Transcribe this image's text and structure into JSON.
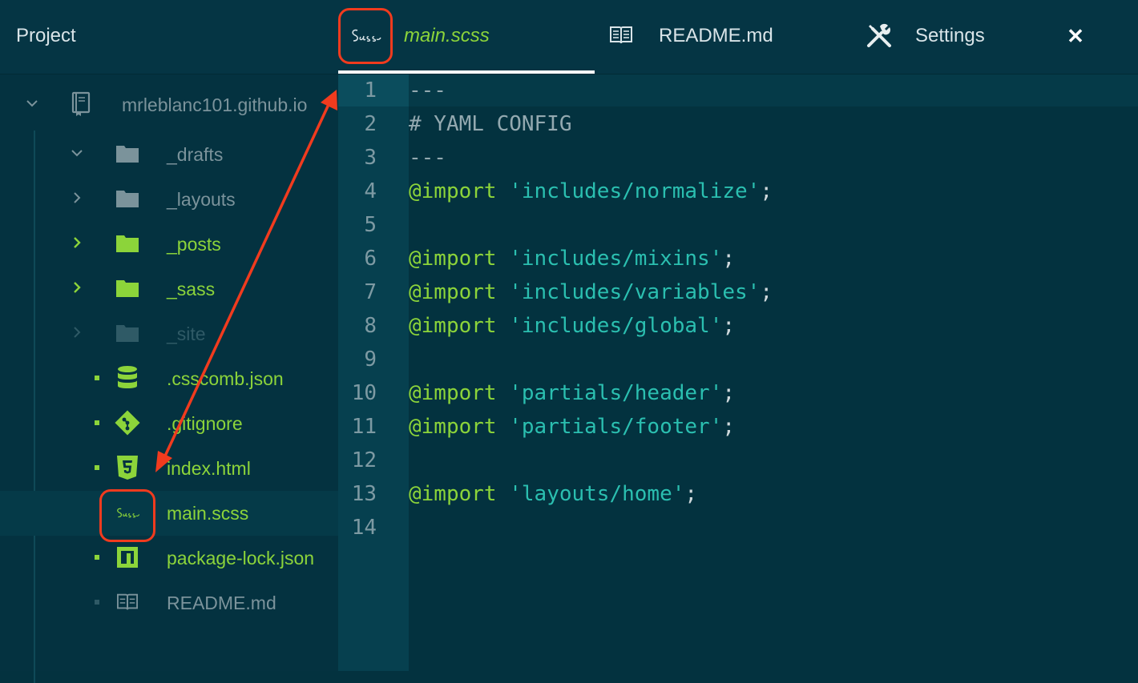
{
  "topbar": {
    "project_label": "Project",
    "tabs": [
      {
        "label": "main.scss",
        "icon": "sass-icon",
        "active": true
      },
      {
        "label": "README.md",
        "icon": "book-icon",
        "active": false
      },
      {
        "label": "Settings",
        "icon": "tools-icon",
        "active": false
      }
    ],
    "close_glyph": "✕"
  },
  "sidebar": {
    "root": {
      "label": "mrleblanc101.github.io",
      "icon": "repo-icon",
      "expanded": true
    },
    "items": [
      {
        "label": "_drafts",
        "type": "folder",
        "expanded": true,
        "color": "#7b939b"
      },
      {
        "label": "_layouts",
        "type": "folder",
        "expanded": false,
        "color": "#7b939b"
      },
      {
        "label": "_posts",
        "type": "folder",
        "expanded": false,
        "color": "#8cd43a"
      },
      {
        "label": "_sass",
        "type": "folder",
        "expanded": false,
        "color": "#8cd43a"
      },
      {
        "label": "_site",
        "type": "folder",
        "expanded": false,
        "color": "#2f5a66"
      },
      {
        "label": ".csscomb.json",
        "type": "file",
        "icon": "database-icon",
        "color": "#8cd43a"
      },
      {
        "label": ".gitignore",
        "type": "file",
        "icon": "git-icon",
        "color": "#8cd43a"
      },
      {
        "label": "index.html",
        "type": "file",
        "icon": "html5-icon",
        "color": "#8cd43a"
      },
      {
        "label": "main.scss",
        "type": "file",
        "icon": "sass-icon",
        "color": "#8cd43a",
        "selected": true
      },
      {
        "label": "package-lock.json",
        "type": "file",
        "icon": "npm-icon",
        "color": "#8cd43a"
      },
      {
        "label": "README.md",
        "type": "file",
        "icon": "book-icon",
        "color": "#7b939b"
      }
    ]
  },
  "editor": {
    "line_numbers": [
      "1",
      "2",
      "3",
      "4",
      "5",
      "6",
      "7",
      "8",
      "9",
      "10",
      "11",
      "12",
      "13",
      "14"
    ],
    "lines": [
      [
        {
          "t": "---",
          "c": "comment"
        }
      ],
      [
        {
          "t": "# YAML CONFIG",
          "c": "comment"
        }
      ],
      [
        {
          "t": "---",
          "c": "comment"
        }
      ],
      [
        {
          "t": "@import",
          "c": "kw"
        },
        {
          "t": " ",
          "c": "ws"
        },
        {
          "t": "'includes/normalize'",
          "c": "str"
        },
        {
          "t": ";",
          "c": "punc"
        }
      ],
      [],
      [
        {
          "t": "@import",
          "c": "kw"
        },
        {
          "t": " ",
          "c": "ws"
        },
        {
          "t": "'includes/mixins'",
          "c": "str"
        },
        {
          "t": ";",
          "c": "punc"
        }
      ],
      [
        {
          "t": "@import",
          "c": "kw"
        },
        {
          "t": " ",
          "c": "ws"
        },
        {
          "t": "'includes/variables'",
          "c": "str"
        },
        {
          "t": ";",
          "c": "punc"
        }
      ],
      [
        {
          "t": "@import",
          "c": "kw"
        },
        {
          "t": " ",
          "c": "ws"
        },
        {
          "t": "'includes/global'",
          "c": "str"
        },
        {
          "t": ";",
          "c": "punc"
        }
      ],
      [],
      [
        {
          "t": "@import",
          "c": "kw"
        },
        {
          "t": " ",
          "c": "ws"
        },
        {
          "t": "'partials/header'",
          "c": "str"
        },
        {
          "t": ";",
          "c": "punc"
        }
      ],
      [
        {
          "t": "@import",
          "c": "kw"
        },
        {
          "t": " ",
          "c": "ws"
        },
        {
          "t": "'partials/footer'",
          "c": "str"
        },
        {
          "t": ";",
          "c": "punc"
        }
      ],
      [],
      [
        {
          "t": "@import",
          "c": "kw"
        },
        {
          "t": " ",
          "c": "ws"
        },
        {
          "t": "'layouts/home'",
          "c": "str"
        },
        {
          "t": ";",
          "c": "punc"
        }
      ],
      []
    ]
  },
  "colors": {
    "accent_green": "#8cd43a",
    "annotation_red": "#f13b1e",
    "string_teal": "#2bbfb0"
  }
}
